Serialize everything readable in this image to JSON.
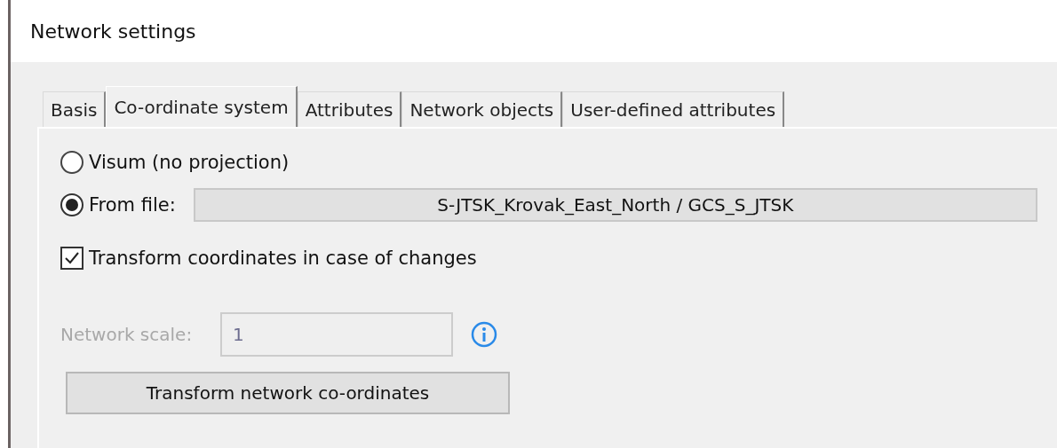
{
  "window": {
    "title": "Network settings"
  },
  "tabs": [
    {
      "label": "Basis",
      "selected": false
    },
    {
      "label": "Co-ordinate system",
      "selected": true
    },
    {
      "label": "Attributes",
      "selected": false
    },
    {
      "label": "Network objects",
      "selected": false
    },
    {
      "label": "User-defined attributes",
      "selected": false
    }
  ],
  "projection_options": [
    {
      "label": "Visum (no projection)",
      "selected": false
    },
    {
      "label": "From file:",
      "selected": true,
      "file_button": "S-JTSK_Krovak_East_North / GCS_S_JTSK"
    }
  ],
  "transform_checkbox": {
    "label": "Transform coordinates in case of changes",
    "checked": true
  },
  "network_scale": {
    "label": "Network scale:",
    "value": "1",
    "disabled": true
  },
  "transform_button": "Transform network co-ordinates"
}
